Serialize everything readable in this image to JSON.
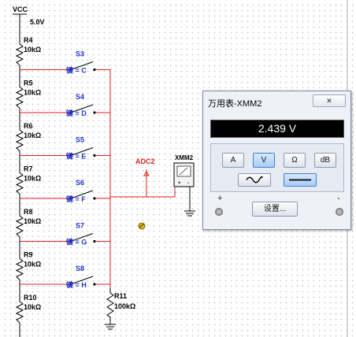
{
  "schematic": {
    "vcc_label": "VCC",
    "vcc_voltage": "5.0V",
    "resistors": [
      {
        "name": "R4",
        "value": "10kΩ"
      },
      {
        "name": "R5",
        "value": "10kΩ"
      },
      {
        "name": "R6",
        "value": "10kΩ"
      },
      {
        "name": "R7",
        "value": "10kΩ"
      },
      {
        "name": "R8",
        "value": "10kΩ"
      },
      {
        "name": "R9",
        "value": "10kΩ"
      },
      {
        "name": "R10",
        "value": "10kΩ"
      }
    ],
    "switches": [
      {
        "name": "S3",
        "key": "键 = C"
      },
      {
        "name": "S4",
        "key": "键 = D"
      },
      {
        "name": "S5",
        "key": "键 = E"
      },
      {
        "name": "S6",
        "key": "键 = F"
      },
      {
        "name": "S7",
        "key": "键 = G"
      },
      {
        "name": "S8",
        "key": "键 = H"
      }
    ],
    "pulldown": {
      "name": "R11",
      "value": "100kΩ"
    },
    "probe_label": "ADC2",
    "instrument_label": "XMM2",
    "meter_plus": "+",
    "meter_minus": "-"
  },
  "multimeter": {
    "title": "万用表-XMM2",
    "reading": "2.439 V",
    "mode_buttons": [
      "A",
      "V",
      "Ω",
      "dB"
    ],
    "active_mode": "V",
    "waveform_buttons": [
      "ac",
      "dc"
    ],
    "active_waveform": "dc",
    "settings_label": "设置...",
    "terminal_plus": "+",
    "terminal_minus": "-"
  },
  "colors": {
    "wire_red": "#dd2222",
    "label_blue": "#2233cc",
    "display_bg": "#000000"
  }
}
